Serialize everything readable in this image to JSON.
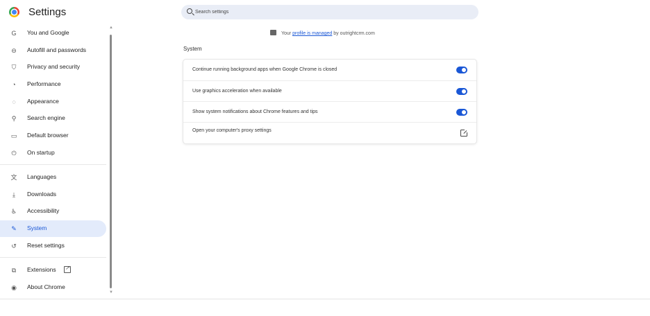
{
  "header": {
    "title": "Settings",
    "search_placeholder": "Search settings"
  },
  "sidebar": {
    "items": [
      {
        "label": "You and Google",
        "icon": "google-g-icon",
        "glyph": "G"
      },
      {
        "label": "Autofill and passwords",
        "icon": "key-icon",
        "glyph": "⊖"
      },
      {
        "label": "Privacy and security",
        "icon": "shield-icon",
        "glyph": "⛉"
      },
      {
        "label": "Performance",
        "icon": "speedometer-icon",
        "glyph": "◔"
      },
      {
        "label": "Appearance",
        "icon": "palette-icon",
        "glyph": "◌"
      },
      {
        "label": "Search engine",
        "icon": "search-icon",
        "glyph": "⚲"
      },
      {
        "label": "Default browser",
        "icon": "browser-window-icon",
        "glyph": "▭"
      },
      {
        "label": "On startup",
        "icon": "power-icon",
        "glyph": "⏻"
      },
      {
        "label": "Languages",
        "icon": "translate-icon",
        "glyph": "文"
      },
      {
        "label": "Downloads",
        "icon": "download-icon",
        "glyph": "⤓"
      },
      {
        "label": "Accessibility",
        "icon": "accessibility-icon",
        "glyph": "♿"
      },
      {
        "label": "System",
        "icon": "wrench-icon",
        "glyph": "🔧"
      },
      {
        "label": "Reset settings",
        "icon": "reset-icon",
        "glyph": "↺"
      },
      {
        "label": "Extensions",
        "icon": "puzzle-icon",
        "glyph": "⧉"
      },
      {
        "label": "About Chrome",
        "icon": "chrome-icon",
        "glyph": "◉"
      }
    ],
    "active": "System"
  },
  "managed": {
    "prefix": "Your",
    "link": "profile is managed",
    "suffix": "by outrightcrm.com"
  },
  "main": {
    "section_title": "System",
    "settings": [
      {
        "label": "Continue running background apps when Google Chrome is closed",
        "control": "toggle",
        "on": true
      },
      {
        "label": "Use graphics acceleration when available",
        "control": "toggle",
        "on": true
      },
      {
        "label": "Show system notifications about Chrome features and tips",
        "control": "toggle",
        "on": true
      },
      {
        "label": "Open your computer's proxy settings",
        "control": "external-link-icon"
      }
    ]
  },
  "colors": {
    "accent": "#1a57d6",
    "active_nav_bg": "#e3ebfb",
    "search_bg": "#e9edf6"
  }
}
